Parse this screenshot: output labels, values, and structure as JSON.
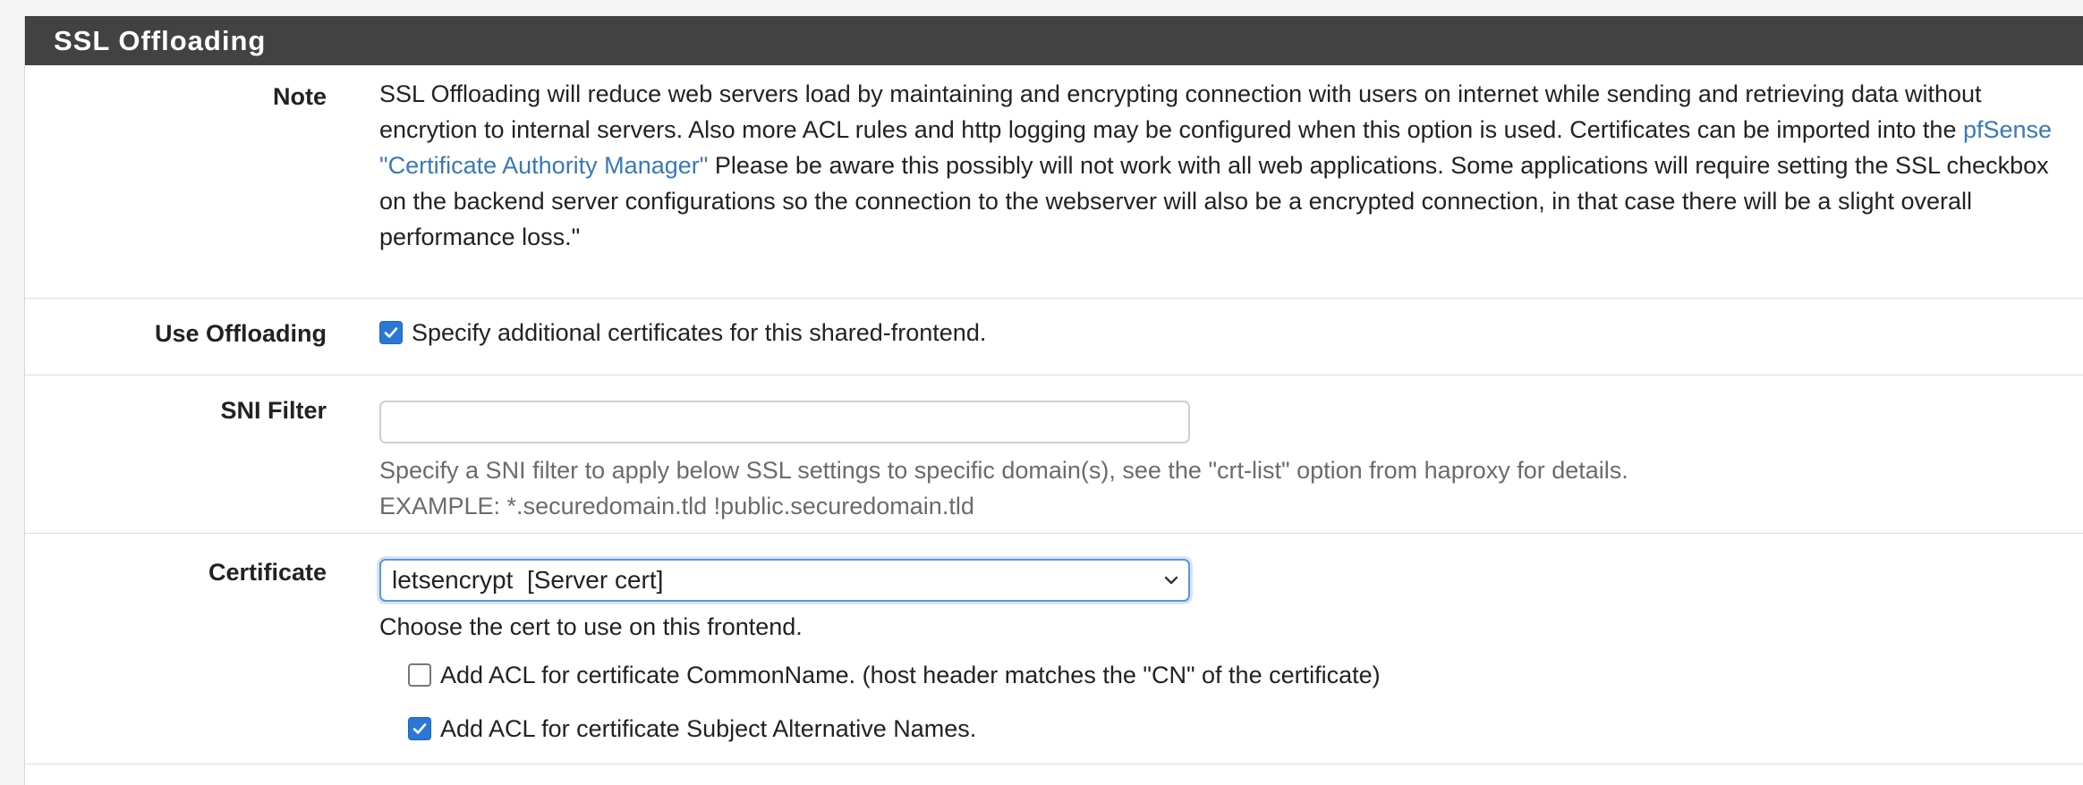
{
  "panel": {
    "title": "SSL Offloading"
  },
  "note": {
    "label": "Note",
    "text_before_link": "SSL Offloading will reduce web servers load by maintaining and encrypting connection with users on internet while sending and retrieving data without encrytion to internal servers. Also more ACL rules and http logging may be configured when this option is used. Certificates can be imported into the",
    "link_text": "pfSense \"Certificate Authority Manager\"",
    "text_after_link": "Please be aware this possibly will not work with all web applications. Some applications will require setting the SSL checkbox on the backend server configurations so the connection to the webserver will also be a encrypted connection, in that case there will be a slight overall performance loss.\""
  },
  "use_offloading": {
    "label": "Use Offloading",
    "checked": true,
    "checkbox_text": "Specify additional certificates for this shared-frontend."
  },
  "sni_filter": {
    "label": "SNI Filter",
    "value": "",
    "help_line1": "Specify a SNI filter to apply below SSL settings to specific domain(s), see the \"crt-list\" option from haproxy for details.",
    "help_line2": "EXAMPLE: *.securedomain.tld !public.securedomain.tld"
  },
  "certificate": {
    "label": "Certificate",
    "selected": "letsencrypt  [Server cert]",
    "help": "Choose the cert to use on this frontend.",
    "acl_common_name": {
      "checked": false,
      "text": "Add ACL for certificate CommonName. (host header matches the \"CN\" of the certificate)"
    },
    "acl_san": {
      "checked": true,
      "text": "Add ACL for certificate Subject Alternative Names."
    }
  },
  "colors": {
    "header_bg": "#424242",
    "link": "#3979b5",
    "checkbox_checked": "#2a78d6",
    "help_text": "#6b6b6b"
  }
}
